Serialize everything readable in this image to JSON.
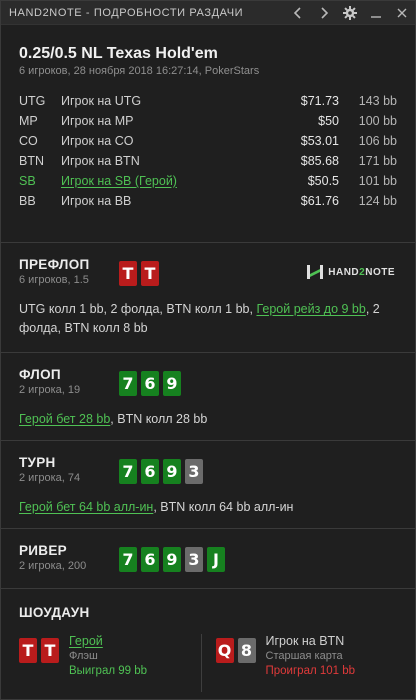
{
  "titlebar": {
    "title": "HAND2NOTE - ПОДРОБНОСТИ РАЗДАЧИ",
    "icons": [
      "chevron-left-icon",
      "chevron-right-icon",
      "gear-icon",
      "minimize-icon",
      "close-icon"
    ]
  },
  "header": {
    "game": "0.25/0.5 NL Texas Hold'em",
    "subtitle": "6 игроков, 28 ноября 2018 16:27:14, PokerStars"
  },
  "players": [
    {
      "pos": "UTG",
      "name": "Игрок на UTG",
      "stack": "$71.73",
      "bb": "143 bb"
    },
    {
      "pos": "MP",
      "name": "Игрок на MP",
      "stack": "$50",
      "bb": "100 bb"
    },
    {
      "pos": "CO",
      "name": "Игрок на CO",
      "stack": "$53.01",
      "bb": "106 bb"
    },
    {
      "pos": "BTN",
      "name": "Игрок на BTN",
      "stack": "$85.68",
      "bb": "171 bb"
    },
    {
      "pos": "SB",
      "name": "Игрок на SB (Герой)",
      "stack": "$50.5",
      "bb": "101 bb"
    },
    {
      "pos": "BB",
      "name": "Игрок на BB",
      "stack": "$61.76",
      "bb": "124 bb"
    }
  ],
  "logo": {
    "text_a": "HAND",
    "text_b": "2",
    "text_c": "NOTE"
  },
  "preflop": {
    "title": "ПРЕФЛОП",
    "sub": "6 игроков, 1.5",
    "cards": [
      {
        "rank": "T",
        "color": "red"
      },
      {
        "rank": "T",
        "color": "red"
      }
    ],
    "actions": {
      "a1": "UTG колл 1 bb, 2 фолда, BTN колл 1 bb, ",
      "hero": "Герой рейз до 9 bb",
      "a2": ", 2 фолда, BTN колл 8 bb"
    }
  },
  "flop": {
    "title": "ФЛОП",
    "sub": "2 игрока, 19",
    "cards": [
      {
        "rank": "7",
        "color": "green"
      },
      {
        "rank": "6",
        "color": "green"
      },
      {
        "rank": "9",
        "color": "green"
      }
    ],
    "actions": {
      "hero": "Герой бет 28 bb",
      "a1": ", BTN колл 28 bb"
    }
  },
  "turn": {
    "title": "ТУРН",
    "sub": "2 игрока, 74",
    "cards": [
      {
        "rank": "7",
        "color": "green"
      },
      {
        "rank": "6",
        "color": "green"
      },
      {
        "rank": "9",
        "color": "green"
      },
      {
        "rank": "3",
        "color": "gray"
      }
    ],
    "actions": {
      "hero": "Герой бет 64 bb алл-ин",
      "a1": ", BTN колл 64 bb алл-ин"
    }
  },
  "river": {
    "title": "РИВЕР",
    "sub": "2 игрока, 200",
    "cards": [
      {
        "rank": "7",
        "color": "green"
      },
      {
        "rank": "6",
        "color": "green"
      },
      {
        "rank": "9",
        "color": "green"
      },
      {
        "rank": "3",
        "color": "gray"
      },
      {
        "rank": "J",
        "color": "green"
      }
    ]
  },
  "showdown": {
    "title": "ШОУДАУН",
    "hero": {
      "cards": [
        {
          "rank": "T",
          "color": "red"
        },
        {
          "rank": "T",
          "color": "red"
        }
      ],
      "name": "Герой",
      "hand": "Флэш",
      "result": "Выиграл 99 bb"
    },
    "villain": {
      "cards": [
        {
          "rank": "Q",
          "color": "red"
        },
        {
          "rank": "8",
          "color": "gray"
        }
      ],
      "name": "Игрок на BTN",
      "hand": "Старшая карта",
      "result": "Проиграл 101 bb"
    }
  },
  "colors": {
    "hero": "#4fc154",
    "win": "#4fc154",
    "lose": "#e03a3a",
    "card_red": "#b91c1c",
    "card_green": "#16811f",
    "card_gray": "#6b6b6b"
  }
}
